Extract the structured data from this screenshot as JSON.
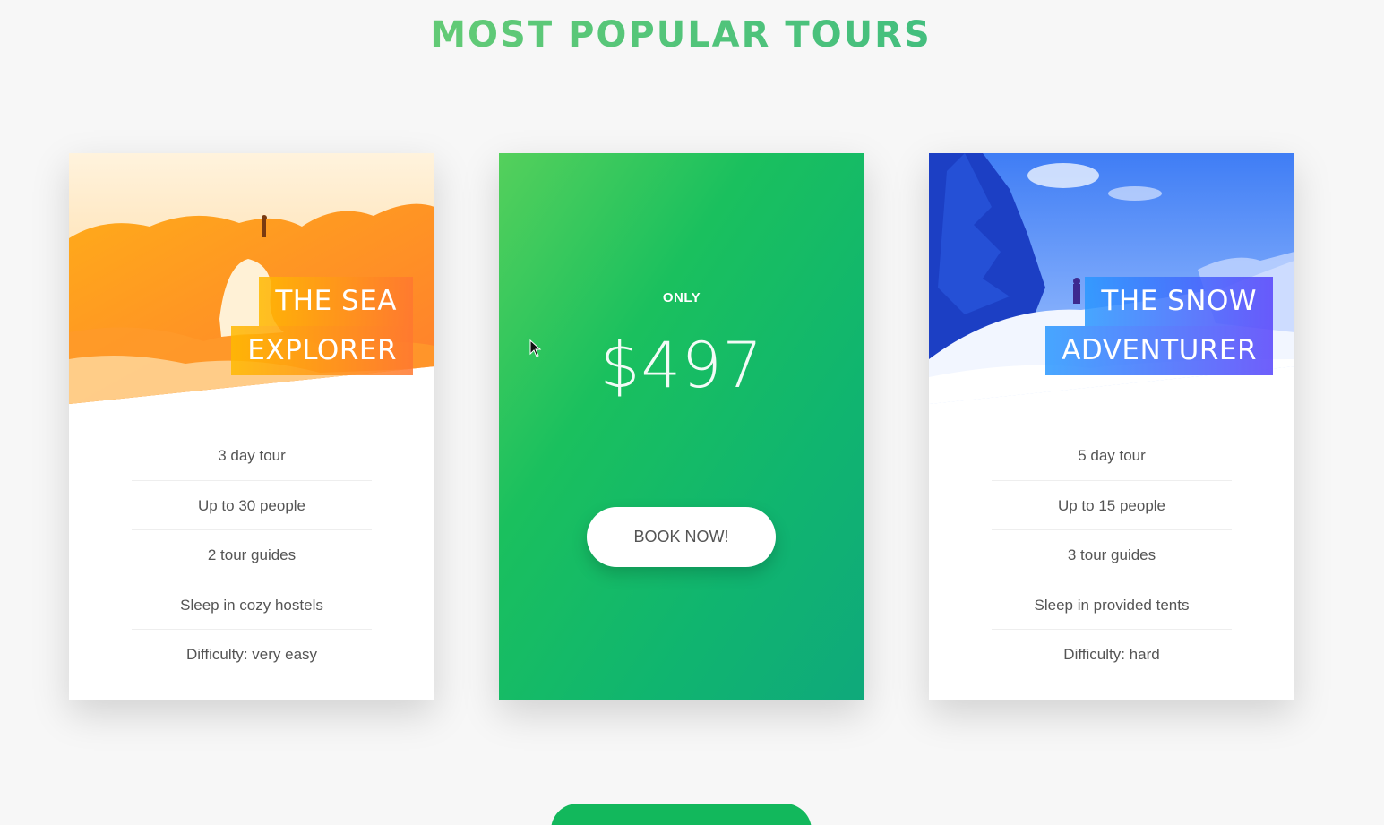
{
  "section": {
    "title": "MOST POPULAR TOURS"
  },
  "cards": [
    {
      "heading_line_1": "THE SEA",
      "heading_line_2": "EXPLORER",
      "details": [
        "3 day tour",
        "Up to 30 people",
        "2 tour guides",
        "Sleep in cozy hostels",
        "Difficulty: very easy"
      ]
    },
    {
      "heading_line_1": "THE SNOW",
      "heading_line_2": "ADVENTURER",
      "details": [
        "5 day tour",
        "Up to 15 people",
        "3 tour guides",
        "Sleep in provided tents",
        "Difficulty: hard"
      ]
    }
  ],
  "price_card": {
    "only_label": "ONLY",
    "price": "$497",
    "button_label": "BOOK NOW!"
  },
  "colors": {
    "primary_green": "#28b485",
    "light_green": "#7ed56f",
    "orange_light": "#ffb900",
    "orange_dark": "#ff7730",
    "blue_light": "#2998ff",
    "blue_dark": "#5643fa"
  },
  "icons": {
    "cursor": "mouse-pointer-icon"
  }
}
